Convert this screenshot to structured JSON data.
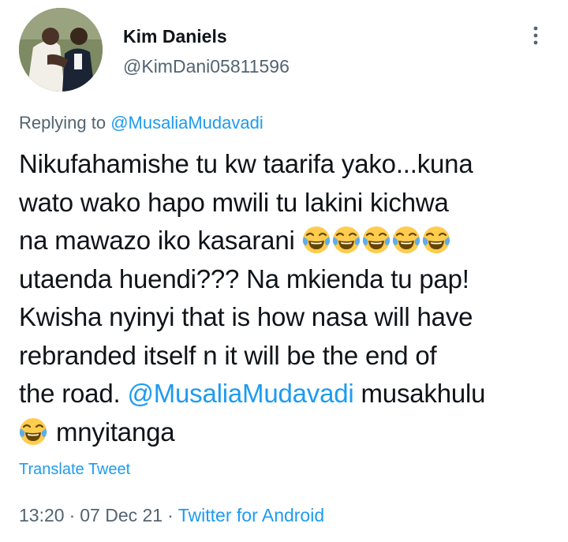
{
  "author": {
    "display_name": "Kim Daniels",
    "handle": "@KimDani05811596"
  },
  "reply": {
    "prefix": "Replying to",
    "mention": "@MusaliaMudavadi"
  },
  "tweet": {
    "line1": "Nikufahamishe tu kw taarifa yako...kuna",
    "line2": "wato wako hapo mwili tu lakini kichwa",
    "line3": "na mawazo iko kasarani",
    "line4": "utaenda huendi??? Na mkienda tu pap!",
    "line5": "Kwisha nyinyi that is how nasa will have",
    "line6": "rebranded itself n it will be the end of",
    "line7_pre": "the road. ",
    "line7_mention": "@MusaliaMudavadi",
    "line7_post": " musakhulu",
    "line8": "mnyitanga",
    "emoji_name": "face-with-tears-of-joy",
    "emoji_count_line3": 5
  },
  "translate_label": "Translate Tweet",
  "meta": {
    "time": "13:20",
    "date": "07 Dec 21",
    "source": "Twitter for Android",
    "separator": "·"
  },
  "colors": {
    "text": "#0f1419",
    "secondary": "#536471",
    "link": "#1d9bf0"
  },
  "icons": {
    "more": "more-vertical-icon",
    "emoji": "face-with-tears-of-joy-emoji"
  }
}
